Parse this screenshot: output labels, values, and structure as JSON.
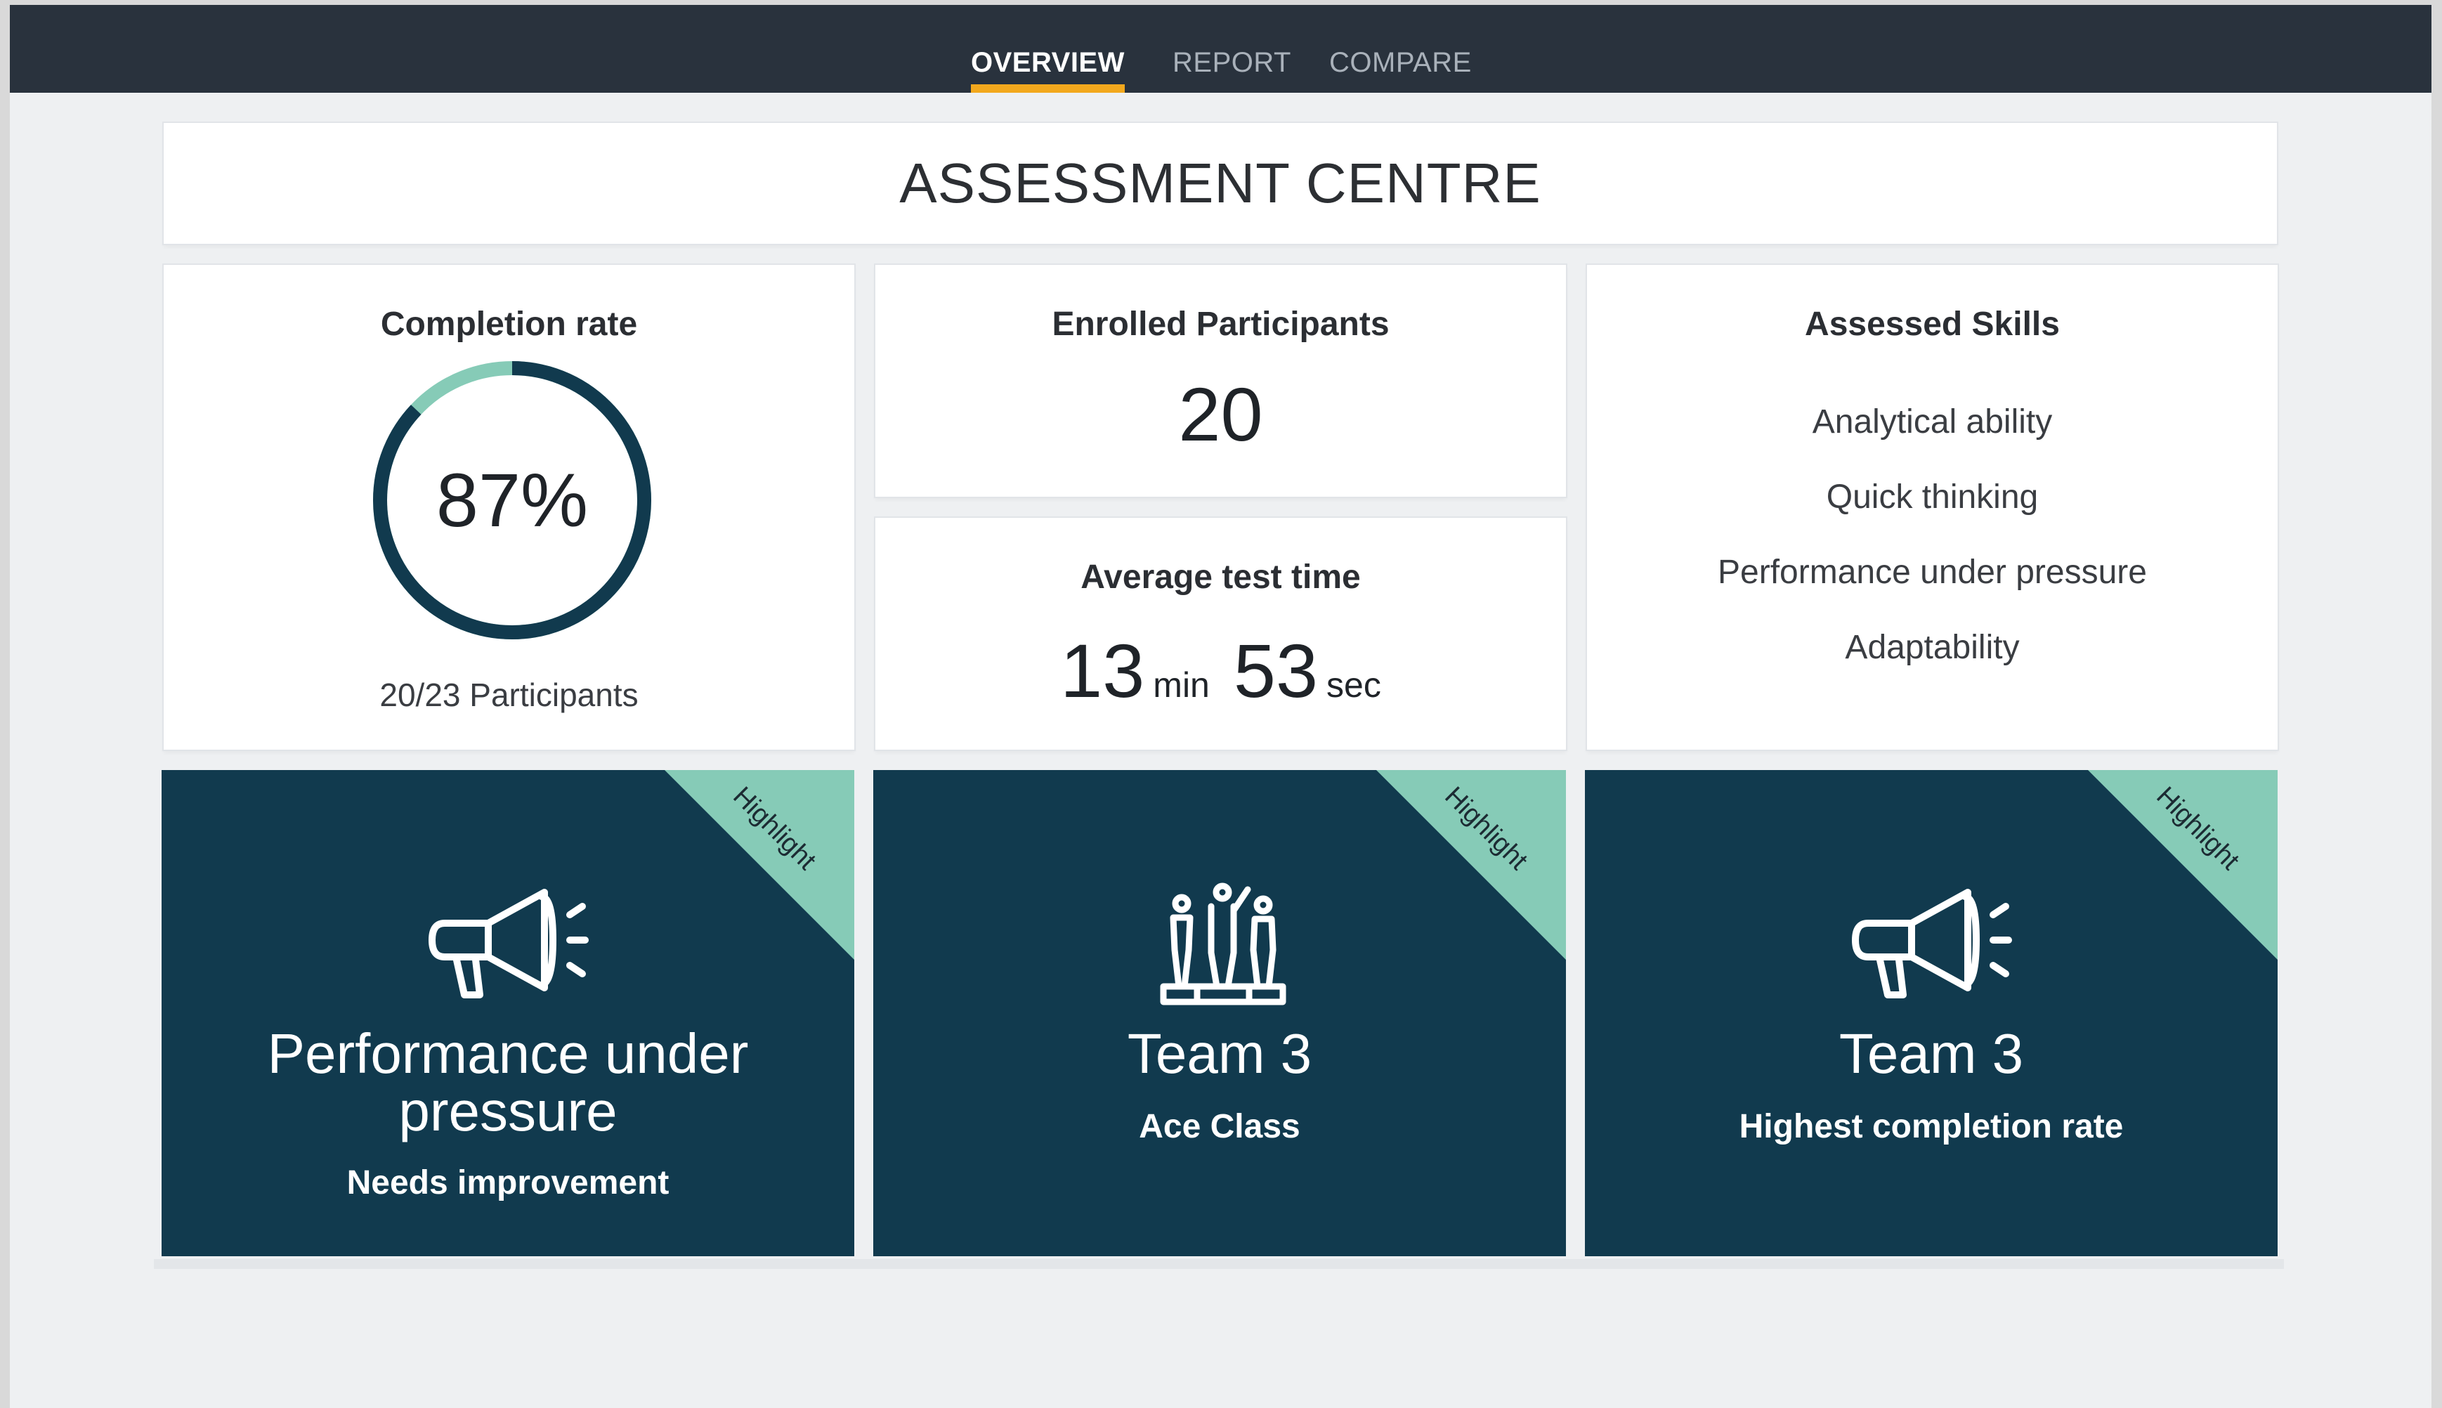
{
  "nav": {
    "tabs": [
      {
        "label": "OVERVIEW",
        "active": true
      },
      {
        "label": "REPORT",
        "active": false
      },
      {
        "label": "COMPARE",
        "active": false
      }
    ],
    "accent_color": "#f2a81d"
  },
  "page_title": "ASSESSMENT CENTRE",
  "completion": {
    "heading": "Completion rate",
    "value_label": "87%",
    "value_fraction": 0.87,
    "participants": "20/23 Participants",
    "ring_color": "#113a4e",
    "ring_remainder_color": "#86cbb7"
  },
  "enrolled": {
    "heading": "Enrolled Participants",
    "value": "20"
  },
  "avg_time": {
    "heading": "Average test time",
    "minutes": "13",
    "min_unit": "min",
    "seconds": "53",
    "sec_unit": "sec"
  },
  "skills": {
    "heading": "Assessed Skills",
    "items": [
      "Analytical ability",
      "Quick thinking",
      "Performance under pressure",
      "Adaptability"
    ]
  },
  "highlights": [
    {
      "ribbon": "Highlight",
      "icon": "megaphone-icon",
      "title_line1": "Performance under",
      "title_line2": "pressure",
      "subtitle": "Needs improvement"
    },
    {
      "ribbon": "Highlight",
      "icon": "podium-icon",
      "title_line1": "Team 3",
      "subtitle": "Ace Class"
    },
    {
      "ribbon": "Highlight",
      "icon": "megaphone-icon",
      "title_line1": "Team 3",
      "subtitle": "Highest completion rate"
    }
  ],
  "colors": {
    "navbar": "#29323d",
    "highlight_card": "#113a4e",
    "ribbon": "#86cbb7"
  }
}
